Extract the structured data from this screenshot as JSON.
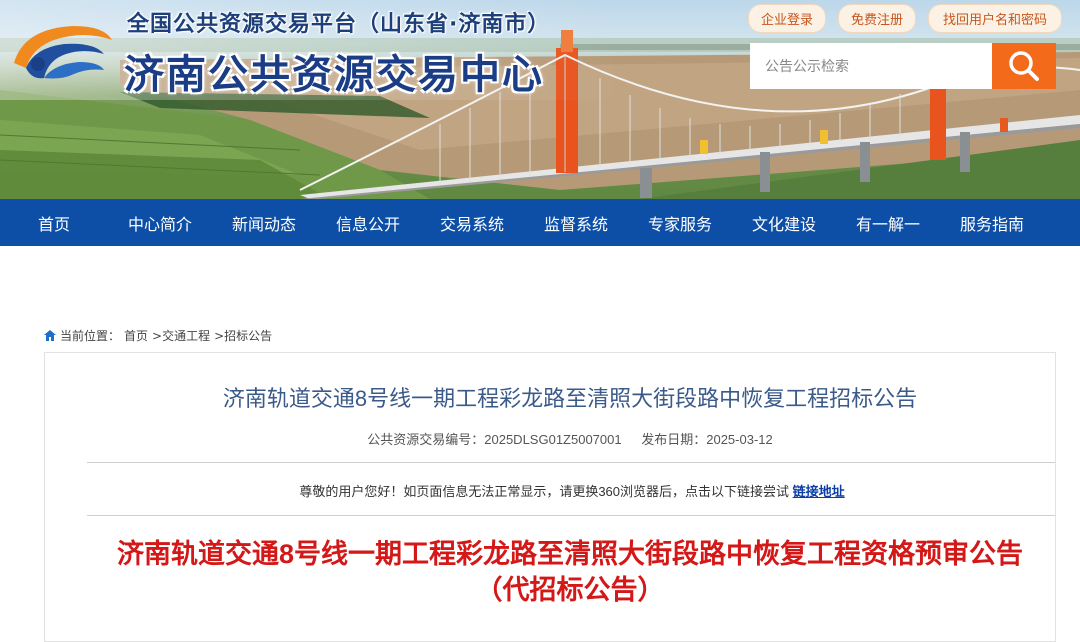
{
  "header": {
    "platform_line": "全国公共资源交易平台（山东省·济南市）",
    "site_title": "济南公共资源交易中心",
    "top_links": [
      "企业登录",
      "免费注册",
      "找回用户名和密码"
    ],
    "search_placeholder": "公告公示检索",
    "accent_color": "#f26a1a"
  },
  "nav": {
    "color": "#0d4fa6",
    "items": [
      "首页",
      "中心简介",
      "新闻动态",
      "信息公开",
      "交易系统",
      "监督系统",
      "专家服务",
      "文化建设",
      "有一解一",
      "服务指南"
    ]
  },
  "breadcrumb": {
    "prefix": "当前位置：",
    "items": [
      "首页",
      ">交通工程",
      ">招标公告"
    ]
  },
  "article": {
    "title": "济南轨道交通8号线一期工程彩龙路至清照大街段路中恢复工程招标公告",
    "code_label": "公共资源交易编号：2025DLSG01Z5007001",
    "date_label": "发布日期：2025-03-12",
    "notice_text": "尊敬的用户您好！如页面信息无法正常显示，请更换360浏览器后，点击以下链接尝试",
    "notice_link": "链接地址",
    "headline_line1": "济南轨道交通8号线一期工程彩龙路至清照大街段路中恢复工程资格预审公告",
    "headline_line2": "（代招标公告）"
  }
}
